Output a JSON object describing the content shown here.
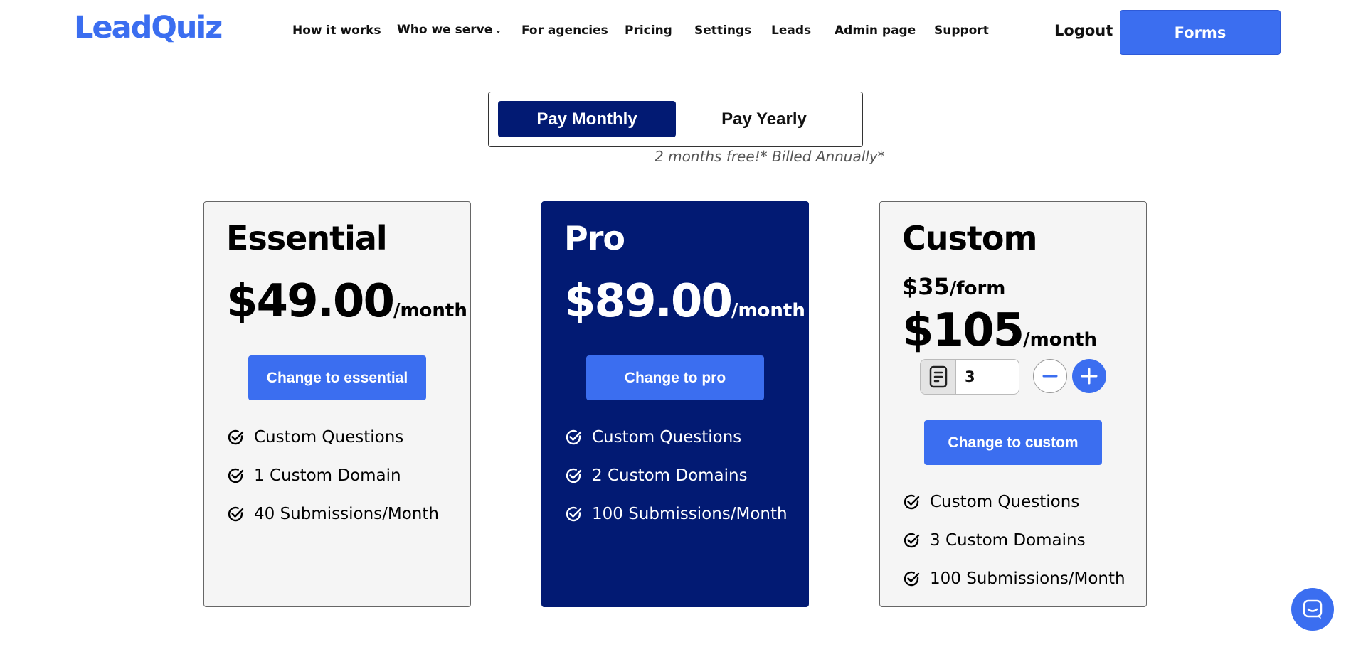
{
  "header": {
    "logo": "LeadQuiz",
    "nav": [
      {
        "label": "How it works"
      },
      {
        "label": "Who we serve",
        "dropdown": true
      },
      {
        "label": "For agencies"
      },
      {
        "label": "Pricing"
      },
      {
        "label": "Settings"
      },
      {
        "label": "Leads"
      },
      {
        "label": "Admin page"
      },
      {
        "label": "Support"
      }
    ],
    "logout_label": "Logout",
    "forms_label": "Forms"
  },
  "billing": {
    "monthly_label": "Pay Monthly",
    "yearly_label": "Pay Yearly",
    "selected": "monthly",
    "note": "2 months free!* Billed Annually*"
  },
  "plans": [
    {
      "name": "Essential",
      "price": "$49.00",
      "period": "/month",
      "button": "Change to essential",
      "features": [
        "Custom Questions",
        "1 Custom Domain",
        "40 Submissions/Month"
      ]
    },
    {
      "name": "Pro",
      "price": "$89.00",
      "period": "/month",
      "button": "Change to pro",
      "features": [
        "Custom Questions",
        "2 Custom Domains",
        "100 Submissions/Month"
      ]
    },
    {
      "name": "Custom",
      "per_form_price": "$35",
      "per_form_unit": "/form",
      "price": "$105",
      "period": "/month",
      "quantity": "3",
      "button": "Change to custom",
      "features": [
        "Custom Questions",
        "3 Custom Domains",
        "100 Submissions/Month"
      ]
    }
  ],
  "icons": {
    "check": "check-circle-icon",
    "form": "form-icon",
    "minus": "minus-icon",
    "plus": "plus-icon",
    "chat": "chat-icon"
  },
  "colors": {
    "accent": "#3b6ef0",
    "navy": "#021a73",
    "card_bg": "#f5f5f5"
  }
}
